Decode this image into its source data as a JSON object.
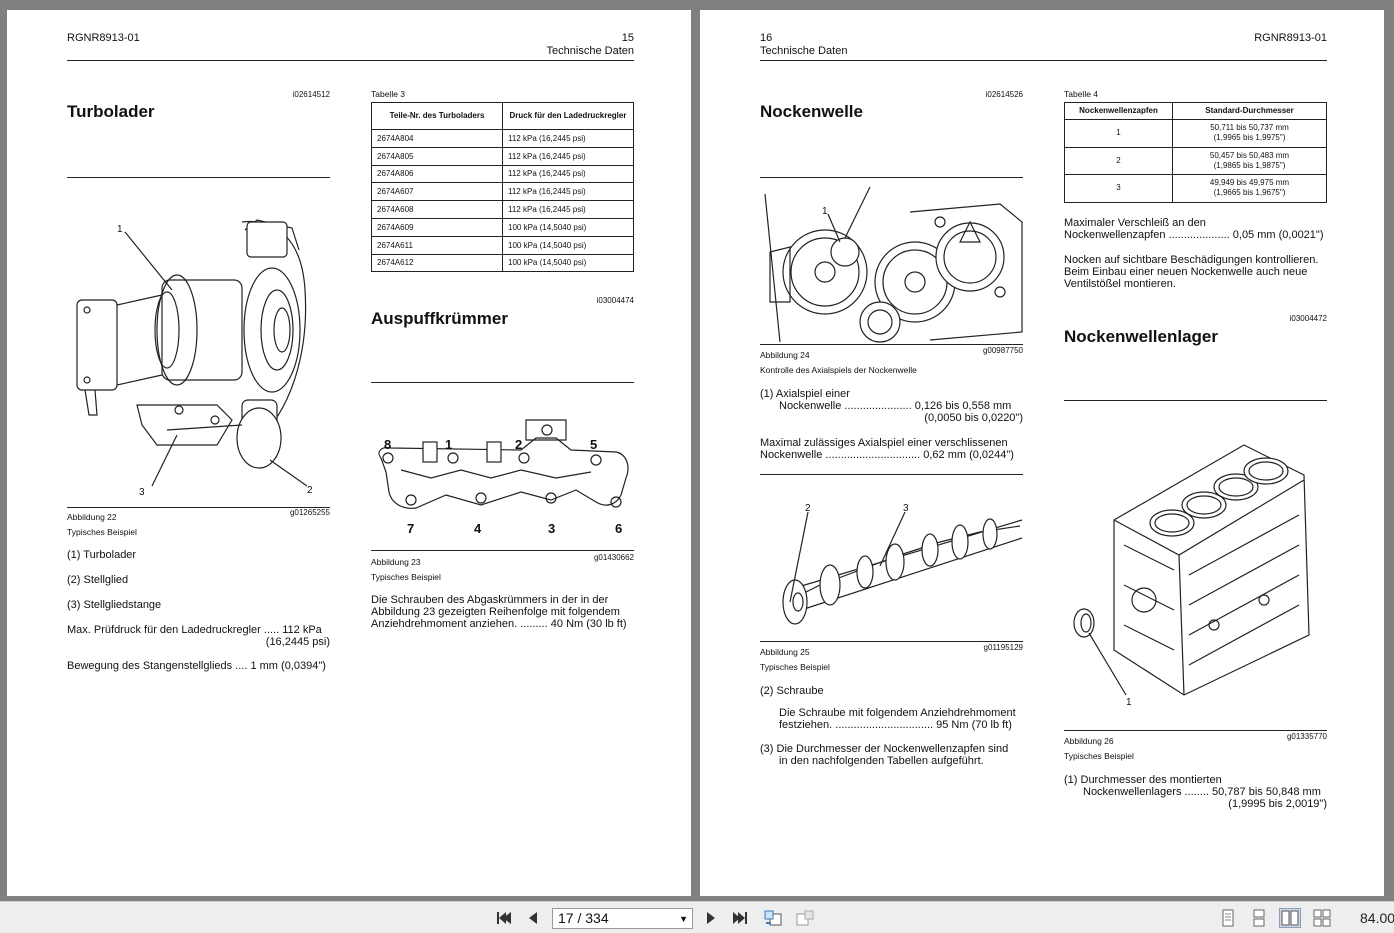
{
  "left": {
    "doc_id": "RGNR8913-01",
    "page_no": "15",
    "section": "Technische Daten",
    "turbo": {
      "ref": "i02614512",
      "title": "Turbolader",
      "fig_caption": "Abbildung 22",
      "fig_code": "g01265255",
      "fig_sub": "Typisches Beispiel",
      "callouts": [
        "1",
        "2",
        "3"
      ],
      "items": [
        "(1) Turbolader",
        "(2) Stellglied",
        "(3) Stellgliedstange"
      ],
      "spec1_label": "Max. Prüfdruck für den Ladedruckregler",
      "spec1_value": "112 kPa",
      "spec1_value2": "(16,2445 psi)",
      "spec2_label": "Bewegung des Stangenstellglieds",
      "spec2_value": "1 mm (0,0394\")"
    },
    "table3": {
      "label": "Tabelle 3",
      "headers": [
        "Teile-Nr. des Turboladers",
        "Druck für den Ladedruckregler"
      ],
      "rows": [
        [
          "2674A804",
          "112 kPa (16,2445 psi)"
        ],
        [
          "2674A805",
          "112 kPa (16,2445 psi)"
        ],
        [
          "2674A806",
          "112 kPa (16,2445 psi)"
        ],
        [
          "2674A607",
          "112 kPa (16,2445 psi)"
        ],
        [
          "2674A608",
          "112 kPa (16,2445 psi)"
        ],
        [
          "2674A609",
          "100 kPa (14,5040 psi)"
        ],
        [
          "2674A611",
          "100 kPa (14,5040 psi)"
        ],
        [
          "2674A612",
          "100 kPa (14,5040 psi)"
        ]
      ]
    },
    "exhaust": {
      "ref": "i03004474",
      "title": "Auspuffkrümmer",
      "callouts_top": [
        "8",
        "1",
        "2",
        "5"
      ],
      "callouts_bottom": [
        "7",
        "4",
        "3",
        "6"
      ],
      "fig_caption": "Abbildung 23",
      "fig_code": "g01430662",
      "fig_sub": "Typisches Beispiel",
      "text_line1": "Die Schrauben des Abgaskrümmers in der in der",
      "text_line2": "Abbildung 23 gezeigten Reihenfolge mit folgendem",
      "text_line3": "Anziehdrehmoment anziehen.",
      "text_value": "40 Nm (30 lb ft)"
    }
  },
  "right": {
    "doc_id": "RGNR8913-01",
    "page_no": "16",
    "section": "Technische Daten",
    "camshaft": {
      "ref": "i02614526",
      "title": "Nockenwelle",
      "fig24_caption": "Abbildung 24",
      "fig24_code": "g00987750",
      "fig24_sub": "Kontrolle des Axialspiels der Nockenwelle",
      "fig24_callout": "1",
      "item1_label1": "(1) Axialspiel einer",
      "item1_label2": "Nockenwelle",
      "item1_value": "0,126 bis 0,558 mm",
      "item1_value2": "(0,0050 bis 0,0220\")",
      "max_label1": "Maximal zulässiges Axialspiel einer verschlissenen",
      "max_label2": "Nockenwelle",
      "max_value": "0,62 mm (0,0244\")",
      "fig25_callouts": [
        "2",
        "3"
      ],
      "fig25_caption": "Abbildung 25",
      "fig25_code": "g01195129",
      "fig25_sub": "Typisches Beispiel",
      "item2": "(2) Schraube",
      "item2_text1": "Die Schraube mit folgendem Anziehdrehmoment",
      "item2_text2": "festziehen.",
      "item2_value": "95 Nm (70 lb ft)",
      "item3_line1": "(3) Die Durchmesser der Nockenwellenzapfen sind",
      "item3_line2": "in den nachfolgenden Tabellen aufgeführt."
    },
    "table4": {
      "label": "Tabelle 4",
      "headers": [
        "Nockenwellenzapfen",
        "Standard-Durchmesser"
      ],
      "rows": [
        [
          "1",
          "50,711 bis 50,737 mm",
          "(1,9965 bis 1,9975\")"
        ],
        [
          "2",
          "50,457 bis 50,483 mm",
          "(1,9865 bis 1,9875\")"
        ],
        [
          "3",
          "49,949 bis 49,975 mm",
          "(1,9665 bis 1,9675\")"
        ]
      ]
    },
    "wear_label1": "Maximaler Verschleiß an den",
    "wear_label2": "Nockenwellenzapfen",
    "wear_value": "0,05 mm (0,0021\")",
    "inspect_line1": "Nocken auf sichtbare Beschädigungen kontrollieren.",
    "inspect_line2": "Beim Einbau einer neuen Nockenwelle auch neue",
    "inspect_line3": "Ventilstößel montieren.",
    "bearing": {
      "ref": "i03004472",
      "title": "Nockenwellenlager",
      "fig_callout": "1",
      "fig_caption": "Abbildung 26",
      "fig_code": "g01335770",
      "fig_sub": "Typisches Beispiel",
      "item1_label1": "(1) Durchmesser des montierten",
      "item1_label2": "Nockenwellenlagers",
      "item1_value": "50,787 bis 50,848 mm",
      "item1_value2": "(1,9995 bis 2,0019\")"
    }
  },
  "toolbar": {
    "page_value": "17 / 334",
    "zoom_value": "84.00"
  }
}
